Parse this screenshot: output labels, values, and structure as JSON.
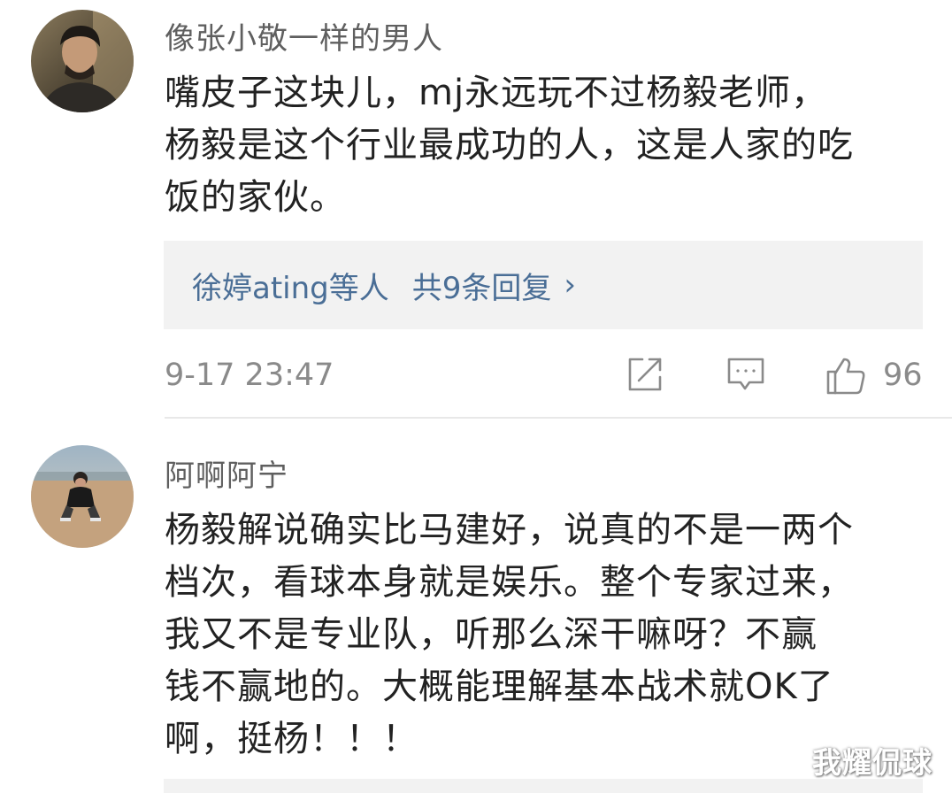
{
  "comments": [
    {
      "username": "像张小敬一样的男人",
      "content_lines": [
        "嘴皮子这块儿，mj永远玩不过杨毅老师，",
        "杨毅是这个行业最成功的人，这是人家的吃",
        "饭的家伙。"
      ],
      "replies": {
        "users": "徐婷ating等人",
        "count_label": "共9条回复",
        "chevron": "›"
      },
      "time": "9-17 23:47",
      "like_count": "96",
      "icons": [
        "repost-icon",
        "comment-icon",
        "like-icon"
      ]
    },
    {
      "username": "阿啊阿宁",
      "content_lines": [
        "杨毅解说确实比马建好，说真的不是一两个",
        "档次，看球本身就是娱乐。整个专家过来，",
        "我又不是专业队，听那么深干嘛呀？不赢",
        "钱不赢地的。大概能理解基本战术就OK了",
        "啊，挺杨！！！"
      ]
    }
  ],
  "watermark": "我耀侃球",
  "colors": {
    "username": "#5f5f5f",
    "content": "#222222",
    "reply_link": "#4a6e96",
    "meta": "#8a8a8a",
    "reply_bg": "#f2f2f2"
  }
}
